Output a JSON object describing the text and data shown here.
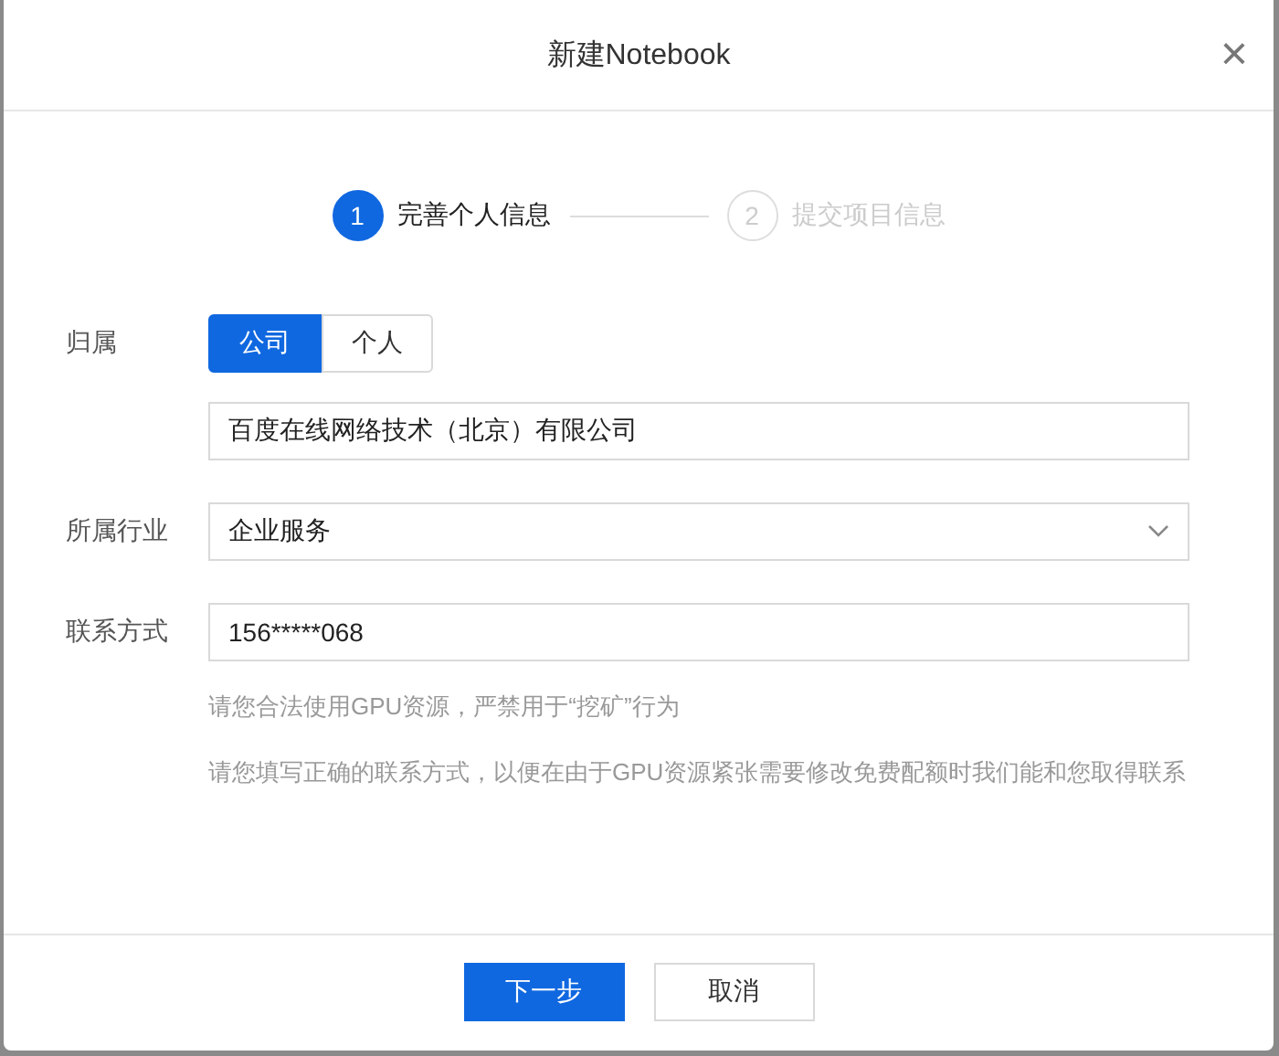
{
  "dialog": {
    "title": "新建Notebook",
    "close": "×"
  },
  "steps": [
    {
      "number": "1",
      "label": "完善个人信息",
      "selected": true
    },
    {
      "number": "2",
      "label": "提交项目信息",
      "selected": false
    }
  ],
  "form": {
    "ownership": {
      "label": "归属",
      "options": [
        {
          "label": "公司",
          "selected": true
        },
        {
          "label": "个人",
          "selected": false
        }
      ]
    },
    "company": {
      "value": "百度在线网络技术（北京）有限公司"
    },
    "industry": {
      "label": "所属行业",
      "value": "企业服务"
    },
    "contact": {
      "label": "联系方式",
      "value": "156*****068"
    },
    "notes": [
      "请您合法使用GPU资源，严禁用于“挖矿”行为",
      "请您填写正确的联系方式，以便在由于GPU资源紧张需要修改免费配额时我们能和您取得联系"
    ]
  },
  "buttons": [
    {
      "label": "下一步",
      "kind": "primary"
    },
    {
      "label": "取消",
      "kind": "secondary"
    }
  ]
}
